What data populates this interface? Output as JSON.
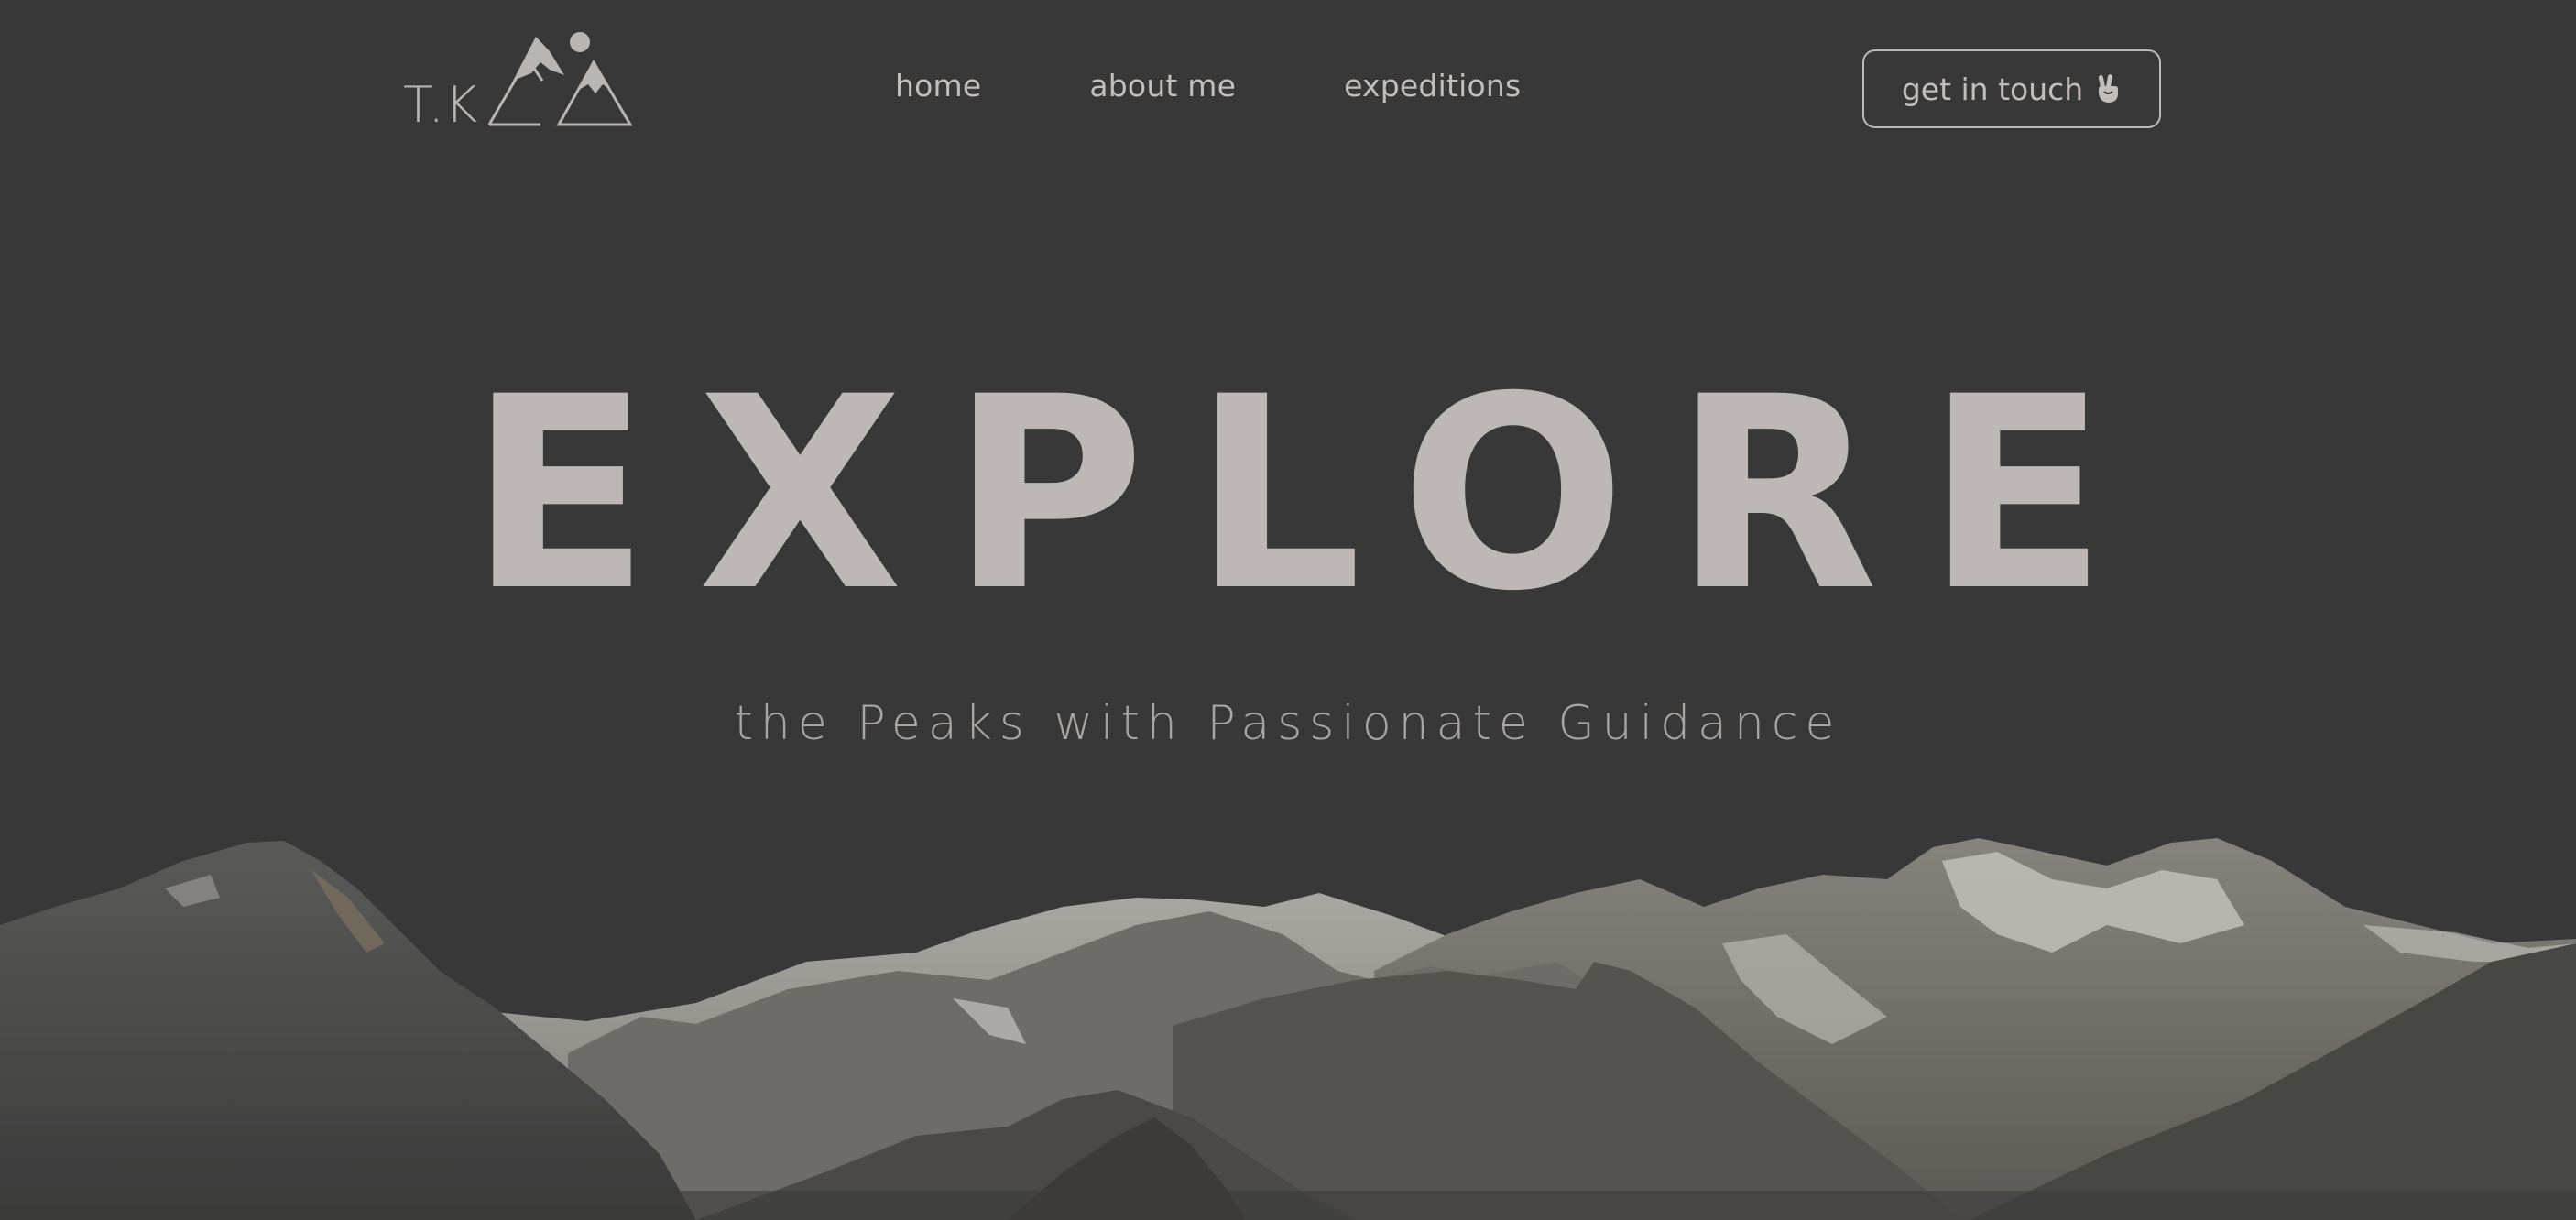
{
  "brand": {
    "logo_text": "T.K",
    "logo_icon": "mountains-sun-logo"
  },
  "nav": {
    "items": [
      {
        "label": "home"
      },
      {
        "label": "about me"
      },
      {
        "label": "expeditions"
      }
    ]
  },
  "cta": {
    "label": "get in touch",
    "icon": "peace-hand-icon"
  },
  "hero": {
    "title": "EXPLORE",
    "subtitle": "the Peaks with Passionate Guidance"
  },
  "colors": {
    "background": "#383838",
    "text_primary": "#bdb8b6",
    "text_nav": "#c2bebc"
  }
}
